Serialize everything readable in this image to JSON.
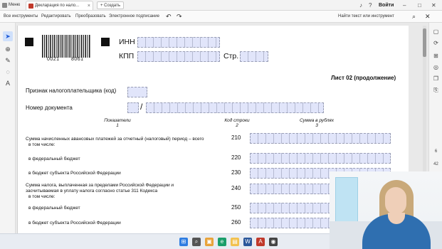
{
  "browser": {
    "tabs": [
      {
        "label": "Меню"
      },
      {
        "label": "Декларация по нало..."
      }
    ],
    "new_tab_label": "Создать",
    "signin_label": "Войти"
  },
  "toolbar": {
    "items": [
      "Все инструменты",
      "Редактировать",
      "Преобразовать",
      "Электронное подписание"
    ],
    "search_label": "Найти текст или инструмент"
  },
  "right_rail": {
    "page_current": "6",
    "page_total": "42"
  },
  "form": {
    "inn_label": "ИНН",
    "kpp_label": "КПП",
    "page_label": "Стр.",
    "barcode_left": "0021",
    "barcode_right": "8061",
    "sheet_title": "Лист 02 (продолжение)",
    "taxpayer_sign_label": "Признак налогоплательщика (код)",
    "doc_number_label": "Номер документа",
    "doc_slash": "/",
    "columns": [
      {
        "name": "Показатели",
        "num": "1"
      },
      {
        "name": "Код строки",
        "num": "2"
      },
      {
        "name": "Сумма в рублях",
        "num": "3"
      }
    ],
    "rows": [
      {
        "label": "Сумма начисленных авансовых платежей за отчетный (налоговый) период – всего",
        "sub": "в том числе:",
        "code": "210"
      },
      {
        "label": "в федеральный бюджет",
        "sub": "",
        "code": "220"
      },
      {
        "label": "в бюджет субъекта Российской Федерации",
        "sub": "",
        "code": "230"
      },
      {
        "label": "Сумма налога, выплаченная за пределами Российской Федерации и засчитываемая в уплату налога согласно статье 311 Кодекса",
        "sub": "в том числе:",
        "code": "240"
      },
      {
        "label": "в федеральный бюджет",
        "sub": "",
        "code": "250"
      },
      {
        "label": "в бюджет субъекта Российской Федерации",
        "sub": "",
        "code": "260"
      }
    ]
  },
  "taskbar": {
    "icons": [
      "windows-start-icon",
      "search-icon",
      "task-view-icon",
      "edge-icon",
      "explorer-icon",
      "chrome-icon",
      "word-icon",
      "mail-icon",
      "acrobat-icon",
      "teams-icon",
      "steam-icon"
    ]
  },
  "colors": {
    "field_fill": "#e1e5fa",
    "field_border": "#9a9fb6",
    "accent": "#1e5ad6",
    "acrobat_red": "#c0392b"
  }
}
